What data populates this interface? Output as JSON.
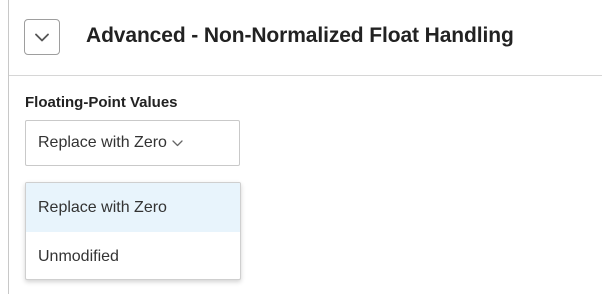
{
  "section": {
    "title": "Advanced - Non-Normalized Float Handling",
    "toggle_icon": "chevron-down-icon"
  },
  "field": {
    "label": "Floating-Point Values",
    "selected_value": "Replace with Zero",
    "chevron_icon": "chevron-down-icon"
  },
  "dropdown": {
    "options": [
      {
        "label": "Replace with Zero",
        "highlighted": true
      },
      {
        "label": "Unmodified",
        "highlighted": false
      }
    ]
  },
  "colors": {
    "highlight": "#e8f4fc",
    "border": "#c9c9c9",
    "text": "#333333"
  }
}
